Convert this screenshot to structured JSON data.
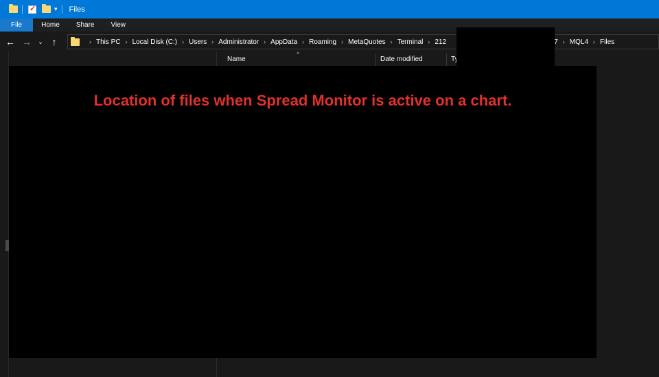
{
  "window": {
    "title": "Files",
    "accent_color": "#0078d7"
  },
  "quick_access": {
    "icons": [
      "folder-icon",
      "properties-icon",
      "new-folder-icon",
      "customize-quick-access-icon"
    ]
  },
  "ribbon": {
    "tabs": [
      {
        "label": "File",
        "active": true
      },
      {
        "label": "Home"
      },
      {
        "label": "Share"
      },
      {
        "label": "View"
      }
    ]
  },
  "navigation": {
    "back": "←",
    "forward": "→",
    "recent": "⌄",
    "up": "↑"
  },
  "address_bar": {
    "breadcrumbs": [
      "This PC",
      "Local Disk (C:)",
      "Users",
      "Administrator",
      "AppData",
      "Roaming",
      "MetaQuotes",
      "Terminal",
      "212",
      "047",
      "MQL4",
      "Files"
    ]
  },
  "columns": {
    "name": "Name",
    "date_modified": "Date modified",
    "type": "Ty",
    "sort_indicator": "^"
  },
  "overlay": {
    "text": "Location of files when Spread Monitor is active on a chart.",
    "text_color": "#e0312c"
  }
}
